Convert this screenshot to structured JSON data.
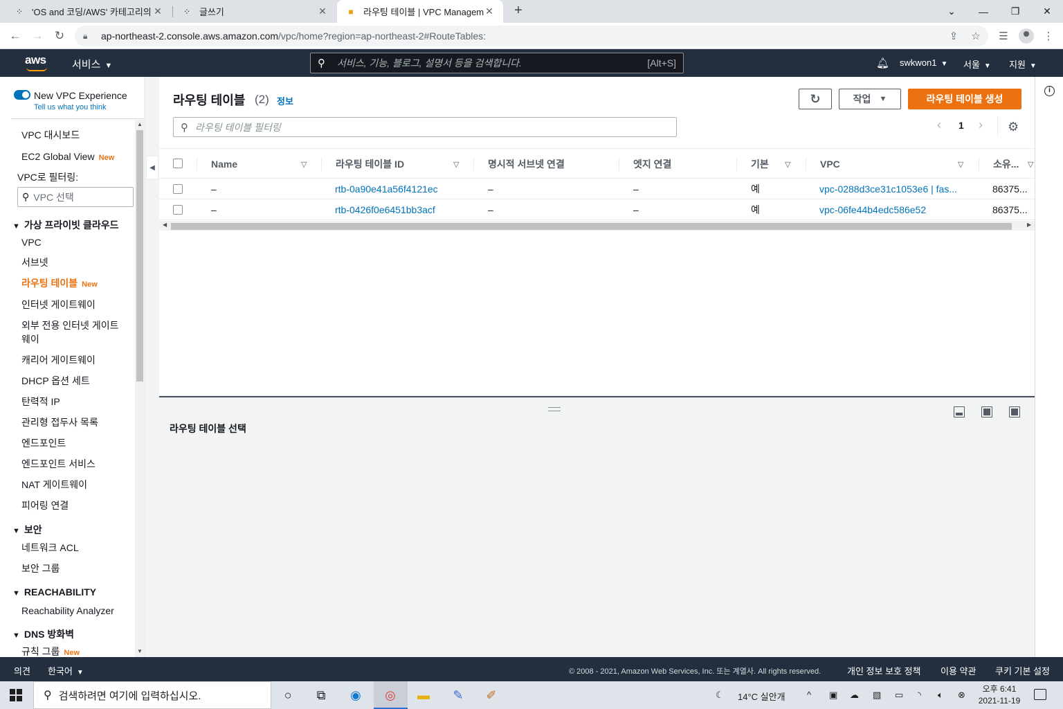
{
  "browser": {
    "tabs": [
      {
        "title": "'OS and 코딩/AWS' 카테고리의",
        "icon": "tistory-icon"
      },
      {
        "title": "글쓰기",
        "icon": "tistory-icon"
      },
      {
        "title": "라우팅 테이블 | VPC Manageme",
        "icon": "aws-cube-icon"
      }
    ],
    "url_host": "ap-northeast-2.console.aws.amazon.com",
    "url_path": "/vpc/home?region=ap-northeast-2#RouteTables:"
  },
  "awsnav": {
    "services_label": "서비스",
    "search_placeholder": "서비스, 기능, 블로그, 설명서 등을 검색합니다.",
    "search_shortcut": "[Alt+S]",
    "account": "swkwon1",
    "region": "서울",
    "support": "지원"
  },
  "sidenav": {
    "toggle_label": "New VPC Experience",
    "toggle_sub": "Tell us what you think",
    "top_items": [
      {
        "label": "VPC 대시보드",
        "badge": ""
      },
      {
        "label": "EC2 Global View",
        "badge": "New"
      }
    ],
    "filter_label": "VPC로 필터링:",
    "filter_placeholder": "VPC 선택",
    "sections": [
      {
        "title": "가상 프라이빗 클라우드",
        "items": [
          {
            "label": "VPC",
            "badge": ""
          },
          {
            "label": "서브넷",
            "badge": ""
          },
          {
            "label": "라우팅 테이블",
            "badge": "New",
            "active": true
          },
          {
            "label": "인터넷 게이트웨이",
            "badge": ""
          },
          {
            "label": "외부 전용 인터넷 게이트",
            "label2": "웨이",
            "badge": ""
          },
          {
            "label": "캐리어 게이트웨이",
            "badge": ""
          },
          {
            "label": "DHCP 옵션 세트",
            "badge": ""
          },
          {
            "label": "탄력적 IP",
            "badge": ""
          },
          {
            "label": "관리형 접두사 목록",
            "badge": ""
          },
          {
            "label": "엔드포인트",
            "badge": ""
          },
          {
            "label": "엔드포인트 서비스",
            "badge": ""
          },
          {
            "label": "NAT 게이트웨이",
            "badge": ""
          },
          {
            "label": "피어링 연결",
            "badge": ""
          }
        ]
      },
      {
        "title": "보안",
        "items": [
          {
            "label": "네트워크 ACL",
            "badge": ""
          },
          {
            "label": "보안 그룹",
            "badge": ""
          }
        ]
      },
      {
        "title": "REACHABILITY",
        "items": [
          {
            "label": "Reachability Analyzer",
            "badge": ""
          }
        ]
      },
      {
        "title": "DNS 방화벽",
        "items": [
          {
            "label": "규칙 그룹",
            "badge": "New"
          }
        ]
      }
    ]
  },
  "main": {
    "title": "라우팅 테이블",
    "count": "(2)",
    "info": "정보",
    "actions_label": "작업",
    "create_label": "라우팅 테이블 생성",
    "filter_placeholder": "라우팅 테이블 필터링",
    "page": "1",
    "columns": [
      "Name",
      "라우팅 테이블 ID",
      "명시적 서브넷 연결",
      "엣지 연결",
      "기본",
      "VPC",
      "소유..."
    ],
    "rows": [
      {
        "name": "–",
        "id": "rtb-0a90e41a56f4121ec",
        "subnet": "–",
        "edge": "–",
        "main": "예",
        "vpc": "vpc-0288d3ce31c1053e6 | fas...",
        "owner": "86375..."
      },
      {
        "name": "–",
        "id": "rtb-0426f0e6451bb3acf",
        "subnet": "–",
        "edge": "–",
        "main": "예",
        "vpc": "vpc-06fe44b4edc586e52",
        "owner": "86375..."
      }
    ],
    "detail_title": "라우팅 테이블 선택"
  },
  "footer": {
    "feedback": "의견",
    "language": "한국어",
    "copyright": "© 2008 - 2021, Amazon Web Services, Inc. 또는 계열사. All rights reserved.",
    "privacy": "개인 정보 보호 정책",
    "terms": "이용 약관",
    "cookies": "쿠키 기본 설정"
  },
  "taskbar": {
    "search_placeholder": "검색하려면 여기에 입력하십시오.",
    "weather": "14°C  실안개",
    "time": "오후 6:41",
    "date": "2021-11-19"
  },
  "colors": {
    "aws_nav": "#232f3e",
    "primary": "#ec7211",
    "link": "#0073bb"
  }
}
